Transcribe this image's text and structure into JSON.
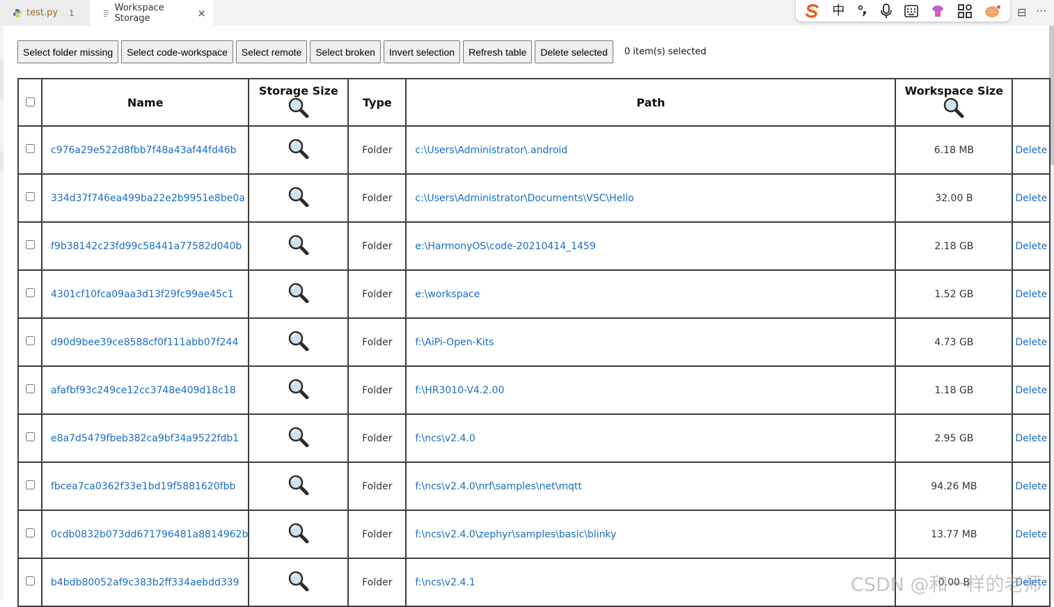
{
  "tabs": [
    {
      "label": "test.py",
      "badge": "1",
      "icon": "python-icon"
    },
    {
      "label": "Workspace Storage",
      "icon": "preview-icon",
      "close": "×"
    }
  ],
  "ime_toolbar": {
    "items": [
      "sogou-logo-icon",
      "中",
      "punctuation-icon",
      "microphone-icon",
      "keyboard-icon",
      "skin-icon",
      "grid-icon",
      "mascot-icon"
    ],
    "zh_label": "中"
  },
  "window_controls": {
    "split": "⊟",
    "more": "···"
  },
  "toolbar": {
    "buttons": [
      "Select folder missing",
      "Select code-workspace",
      "Select remote",
      "Select broken",
      "Invert selection",
      "Refresh table",
      "Delete selected"
    ],
    "selection_status": "0 item(s) selected"
  },
  "table": {
    "headers": {
      "name": "Name",
      "storage_size": "Storage Size",
      "type": "Type",
      "path": "Path",
      "workspace_size": "Workspace Size"
    },
    "rows": [
      {
        "name": "c976a29e522d8fbb7f48a43af44fd46b",
        "type": "Folder",
        "path": "c:\\Users\\Administrator\\.android",
        "workspace_size": "6.18 MB",
        "action": "Delete"
      },
      {
        "name": "334d37f746ea499ba22e2b9951e8be0a",
        "type": "Folder",
        "path": "c:\\Users\\Administrator\\Documents\\VSC\\Hello",
        "workspace_size": "32.00 B",
        "action": "Delete"
      },
      {
        "name": "f9b38142c23fd99c58441a77582d040b",
        "type": "Folder",
        "path": "e:\\HarmonyOS\\code-20210414_1459",
        "workspace_size": "2.18 GB",
        "action": "Delete"
      },
      {
        "name": "4301cf10fca09aa3d13f29fc99ae45c1",
        "type": "Folder",
        "path": "e:\\workspace",
        "workspace_size": "1.52 GB",
        "action": "Delete"
      },
      {
        "name": "d90d9bee39ce8588cf0f111abb07f244",
        "type": "Folder",
        "path": "f:\\AiPi-Open-Kits",
        "workspace_size": "4.73 GB",
        "action": "Delete"
      },
      {
        "name": "afafbf93c249ce12cc3748e409d18c18",
        "type": "Folder",
        "path": "f:\\HR3010-V4.2.00",
        "workspace_size": "1.18 GB",
        "action": "Delete"
      },
      {
        "name": "e8a7d5479fbeb382ca9bf34a9522fdb1",
        "type": "Folder",
        "path": "f:\\ncs\\v2.4.0",
        "workspace_size": "2.95 GB",
        "action": "Delete"
      },
      {
        "name": "fbcea7ca0362f33e1bd19f5881620fbb",
        "type": "Folder",
        "path": "f:\\ncs\\v2.4.0\\nrf\\samples\\net\\mqtt",
        "workspace_size": "94.26 MB",
        "action": "Delete"
      },
      {
        "name": "0cdb0832b073dd671796481a8814962b",
        "type": "Folder",
        "path": "f:\\ncs\\v2.4.0\\zephyr\\samples\\basic\\blinky",
        "workspace_size": "13.77 MB",
        "action": "Delete"
      },
      {
        "name": "b4bdb80052af9c383b2ff334aebdd339",
        "type": "Folder",
        "path": "f:\\ncs\\v2.4.1",
        "workspace_size": "0.00 B",
        "action": "Delete"
      }
    ]
  },
  "watermark": "CSDN @和一样的老师",
  "colors": {
    "link": "#1a6dbf",
    "border": "#3c3c3c",
    "button_bg": "#efefef"
  }
}
